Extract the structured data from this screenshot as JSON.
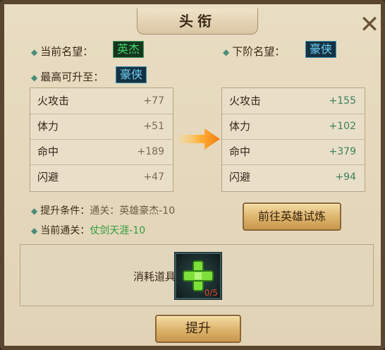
{
  "window": {
    "title": "头衔",
    "close_glyph": "✕"
  },
  "current_rank": {
    "label": "当前名望：",
    "value": "英杰"
  },
  "next_rank": {
    "label": "下阶名望：",
    "value": "豪侠"
  },
  "max_rank": {
    "label": "最高可升至：",
    "value": "豪侠"
  },
  "current_stats": [
    {
      "name": "火攻击",
      "value": "+77"
    },
    {
      "name": "体力",
      "value": "+51"
    },
    {
      "name": "命中",
      "value": "+189"
    },
    {
      "name": "闪避",
      "value": "+47"
    }
  ],
  "next_stats": [
    {
      "name": "火攻击",
      "value": "+155"
    },
    {
      "name": "体力",
      "value": "+102"
    },
    {
      "name": "命中",
      "value": "+379"
    },
    {
      "name": "闪避",
      "value": "+94"
    }
  ],
  "conditions": {
    "requirement_label": "提升条件：",
    "requirement_value": "通关：英雄豪杰-10",
    "current_label": "当前通关：",
    "current_value": "仗剑天涯-10"
  },
  "buttons": {
    "go_trial": "前往英雄试炼",
    "upgrade": "提升"
  },
  "consume": {
    "label": "消耗道具：",
    "item_icon": "green-plus-item-icon",
    "count": "0/5"
  },
  "colors": {
    "rank_green": "#3fd36a",
    "rank_blue": "#6fd0f2",
    "stat_up": "#3e7f5a",
    "arrow": "#f5a623"
  }
}
